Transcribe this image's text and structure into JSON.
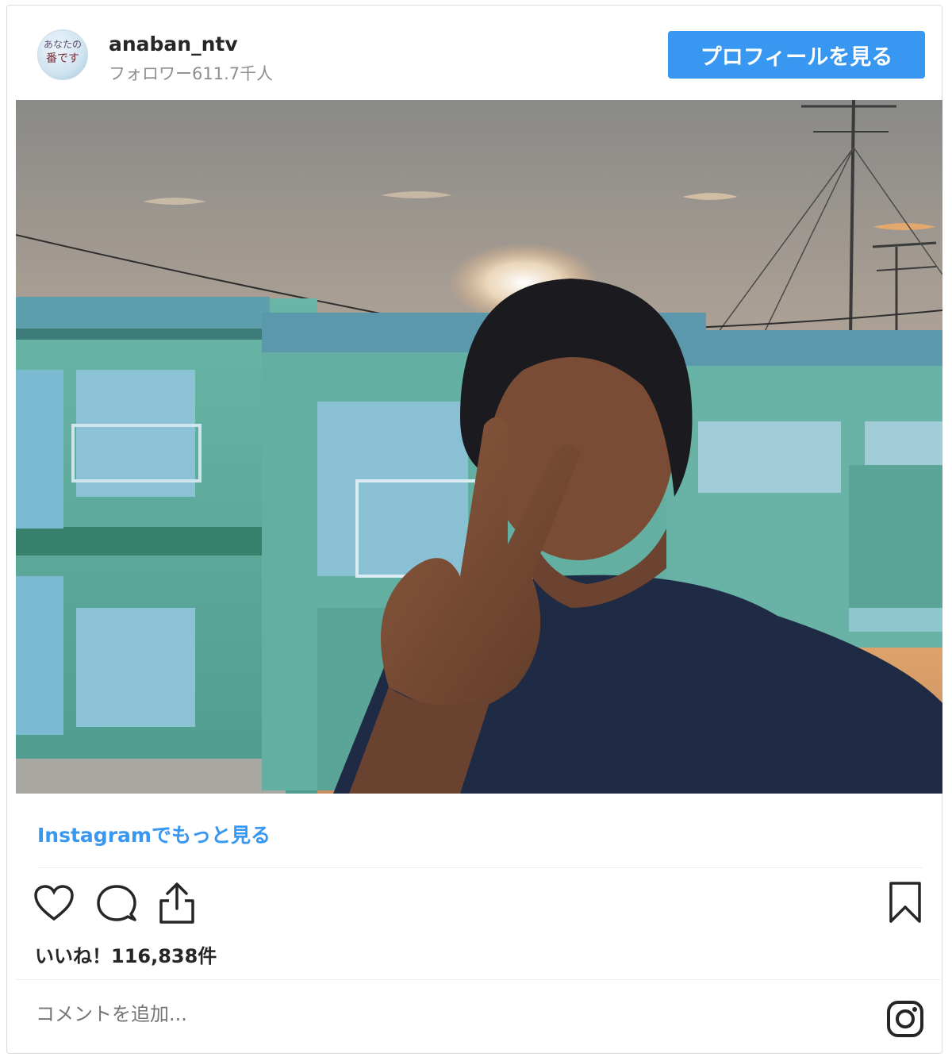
{
  "post": {
    "avatar_text_line1": "あなたの",
    "avatar_text_line2": "番です",
    "username": "anaban_ntv",
    "followers": "フォロワー611.7千人",
    "profile_button": "プロフィールを見る",
    "more_link": "Instagramでもっと見る",
    "likes": "いいね！116,838件",
    "comment_placeholder": "コメントを追加...",
    "icons": {
      "like": "heart-icon",
      "comment": "comment-bubble-icon",
      "share": "share-upload-icon",
      "save": "bookmark-icon",
      "brand": "instagram-logo-icon"
    }
  }
}
